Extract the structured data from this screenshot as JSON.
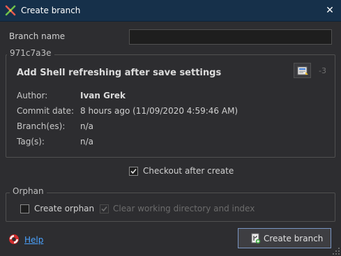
{
  "window": {
    "title": "Create branch",
    "close_glyph": "✕"
  },
  "form": {
    "branch_name_label": "Branch name",
    "branch_name_value": ""
  },
  "commit": {
    "hash": "971c7a3e",
    "message": "Add Shell refreshing after save settings",
    "extra": "-3",
    "fields": {
      "author_label": "Author:",
      "author_value": "Ivan Grek",
      "date_label": "Commit date:",
      "date_value": "8 hours ago (11/09/2020 4:59:46 AM)",
      "branches_label": "Branch(es):",
      "branches_value": "n/a",
      "tags_label": "Tag(s):",
      "tags_value": "n/a"
    }
  },
  "options": {
    "checkout_label": "Checkout after create",
    "checkout_checked": true
  },
  "orphan": {
    "legend": "Orphan",
    "create_orphan_label": "Create orphan",
    "create_orphan_checked": false,
    "clear_label": "Clear working directory and index",
    "clear_checked": true,
    "clear_disabled": true
  },
  "footer": {
    "help_label": "Help",
    "create_button_label": "Create branch"
  },
  "icons": {
    "app": "git-branch-icon",
    "copy": "copy-to-clipboard-icon",
    "help": "lifebuoy-icon",
    "create": "create-branch-icon"
  }
}
